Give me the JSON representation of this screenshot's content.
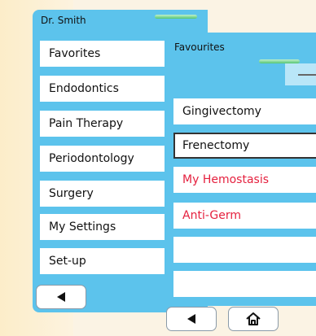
{
  "left_panel": {
    "title": "Dr. Smith",
    "menu": [
      {
        "label": "Favorites"
      },
      {
        "label": "Endodontics"
      },
      {
        "label": "Pain Therapy"
      },
      {
        "label": "Periodontology"
      },
      {
        "label": "Surgery"
      },
      {
        "label": "My Settings"
      },
      {
        "label": "Set-up"
      }
    ],
    "back_icon": "back-triangle-icon"
  },
  "right_panel": {
    "title": "Favourites",
    "items": [
      {
        "label": "Gingivectomy",
        "color": "#111111"
      },
      {
        "label": "Frenectomy",
        "color": "#111111",
        "selected": true
      },
      {
        "label": "My Hemostasis",
        "color": "#e5213f"
      },
      {
        "label": "Anti-Germ",
        "color": "#e5213f"
      },
      {
        "label": ""
      },
      {
        "label": ""
      }
    ],
    "back_icon": "back-triangle-icon",
    "home_icon": "home-icon"
  },
  "colors": {
    "panel": "#5cc3ec",
    "highlight": "#55c673",
    "accent_red": "#e5213f"
  }
}
